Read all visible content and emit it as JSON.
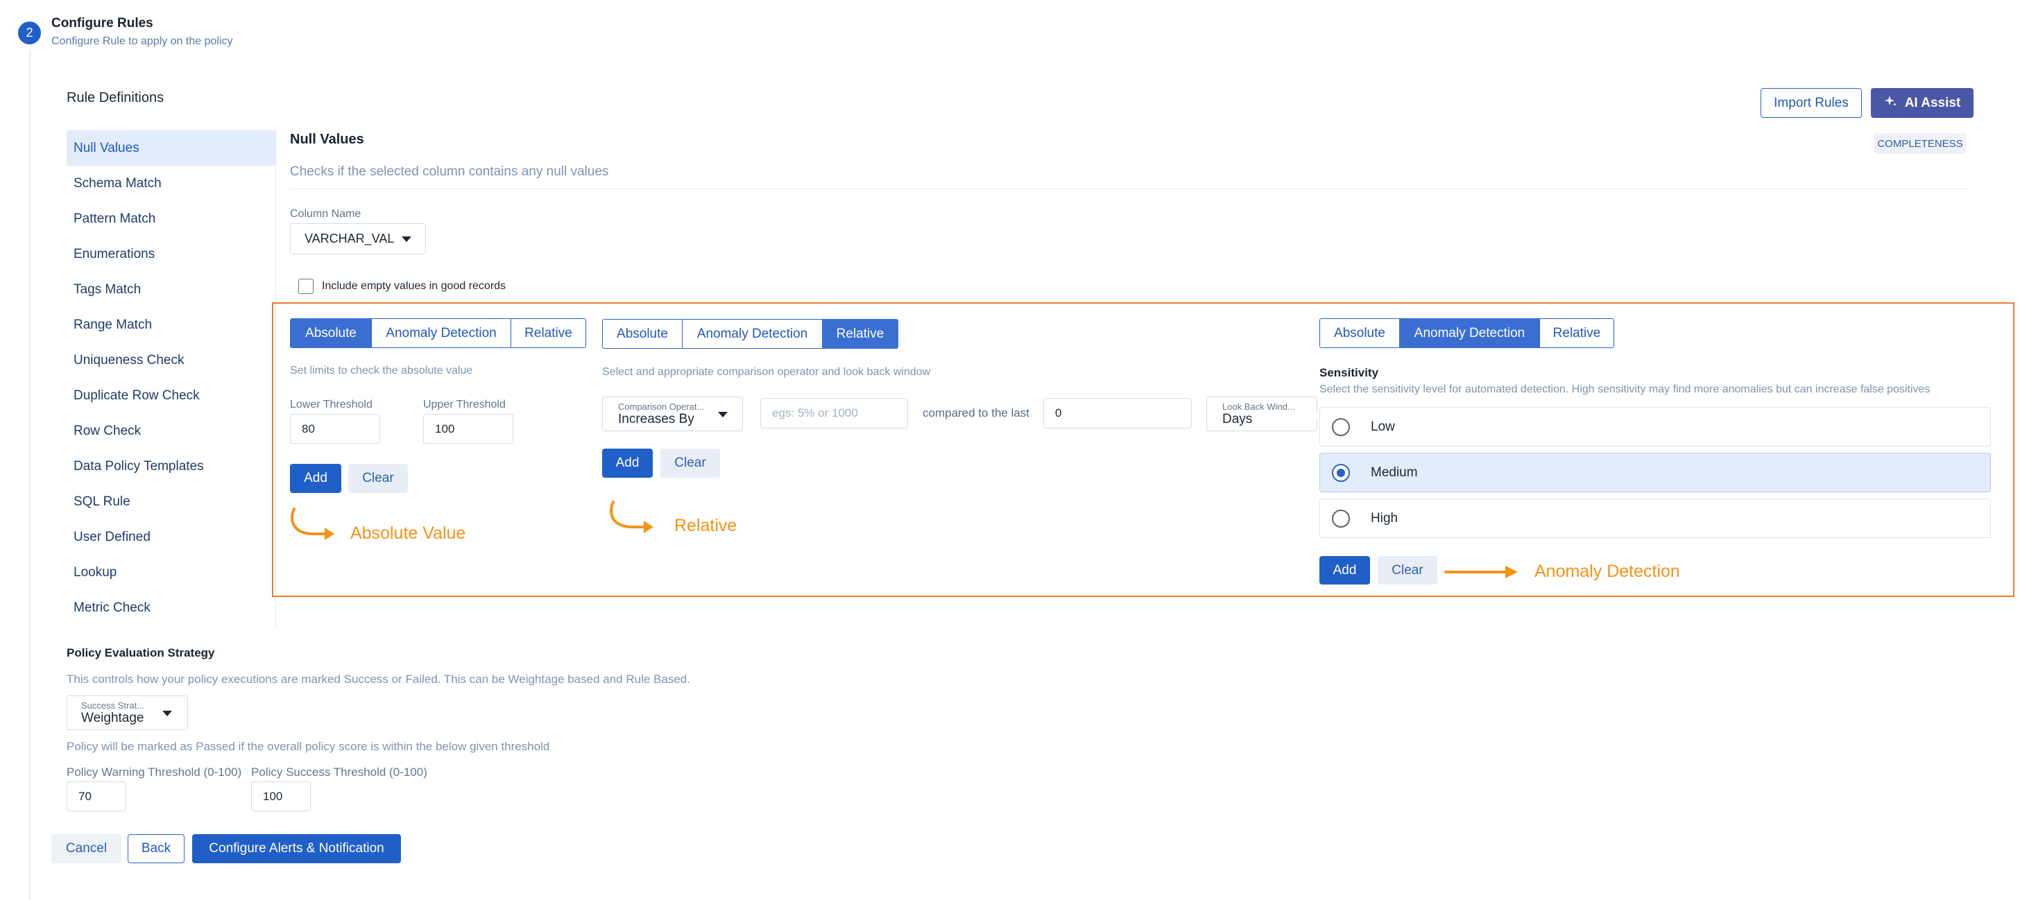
{
  "step": {
    "number": "2",
    "title": "Configure Rules",
    "subtitle": "Configure Rule to apply on the policy"
  },
  "rule_definitions": {
    "title": "Rule Definitions",
    "import_button": "Import Rules",
    "ai_button": "AI Assist"
  },
  "sidebar": {
    "items": [
      {
        "label": "Null Values"
      },
      {
        "label": "Schema Match"
      },
      {
        "label": "Pattern Match"
      },
      {
        "label": "Enumerations"
      },
      {
        "label": "Tags Match"
      },
      {
        "label": "Range Match"
      },
      {
        "label": "Uniqueness Check"
      },
      {
        "label": "Duplicate Row Check"
      },
      {
        "label": "Row Check"
      },
      {
        "label": "Data Policy Templates"
      },
      {
        "label": "SQL Rule"
      },
      {
        "label": "User Defined"
      },
      {
        "label": "Lookup"
      },
      {
        "label": "Metric Check"
      }
    ],
    "active_index": 0
  },
  "panel": {
    "title": "Null Values",
    "description": "Checks if the selected column contains any null values",
    "badge": "COMPLETENESS",
    "column_label": "Column Name",
    "column_value": "VARCHAR_VAL",
    "include_empty_label": "Include empty values in good records",
    "include_empty_checked": false
  },
  "absolute": {
    "tabs": [
      "Absolute",
      "Anomaly Detection",
      "Relative"
    ],
    "selected": "Absolute",
    "description": "Set limits to check the absolute value",
    "lower_label": "Lower Threshold",
    "lower_value": "80",
    "upper_label": "Upper Threshold",
    "upper_value": "100",
    "add": "Add",
    "clear": "Clear",
    "annotation": "Absolute Value"
  },
  "relative": {
    "tabs": [
      "Absolute",
      "Anomaly Detection",
      "Relative"
    ],
    "selected": "Relative",
    "description": "Select and appropriate comparison operator and look back window",
    "operator_label": "Comparison Operat...",
    "operator_value": "Increases By",
    "amount_placeholder": "egs: 5% or 1000",
    "compared_text": "compared to the last",
    "lookback_value": "0",
    "window_label": "Look Back Wind...",
    "window_value": "Days",
    "add": "Add",
    "clear": "Clear",
    "annotation": "Relative"
  },
  "anomaly": {
    "tabs": [
      "Absolute",
      "Anomaly Detection",
      "Relative"
    ],
    "selected": "Anomaly Detection",
    "sensitivity_title": "Sensitivity",
    "sensitivity_desc": "Select the sensitivity level for automated detection. High sensitivity may find more anomalies but can increase false positives",
    "options": [
      "Low",
      "Medium",
      "High"
    ],
    "selected_option": "Medium",
    "add": "Add",
    "clear": "Clear",
    "annotation": "Anomaly Detection"
  },
  "policy": {
    "title": "Policy Evaluation Strategy",
    "description": "This controls how your policy executions are marked Success or Failed. This can be Weightage based and Rule Based.",
    "strategy_label": "Success Strat...",
    "strategy_value": "Weightage",
    "threshold_note": "Policy will be marked as Passed if the overall policy score is within the below given threshold",
    "warning_label": "Policy Warning Threshold (0-100)",
    "warning_value": "70",
    "success_label": "Policy Success Threshold (0-100)",
    "success_value": "100"
  },
  "footer": {
    "cancel": "Cancel",
    "back": "Back",
    "configure": "Configure Alerts & Notification"
  },
  "colors": {
    "primary": "#1f5fc7",
    "annotation_orange": "#f39318",
    "highlight_border": "#f07a2e"
  }
}
